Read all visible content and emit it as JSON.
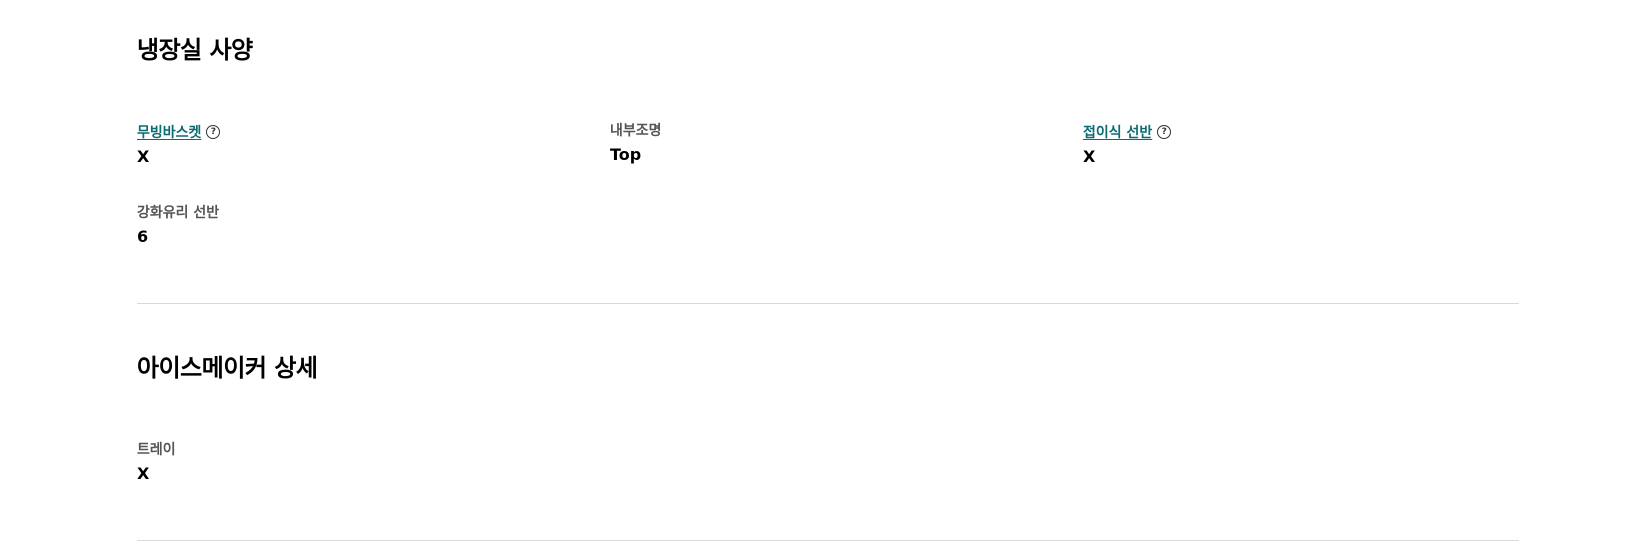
{
  "fridge_section": {
    "title": "냉장실 사양",
    "specs": [
      {
        "label": "무빙바스켓",
        "value": "X",
        "has_help": true
      },
      {
        "label": "내부조명",
        "value": "Top",
        "has_help": false
      },
      {
        "label": "접이식 선반",
        "value": "X",
        "has_help": true
      },
      {
        "label": "강화유리 선반",
        "value": "6",
        "has_help": false
      }
    ]
  },
  "icemaker_section": {
    "title": "아이스메이커 상세",
    "specs": [
      {
        "label": "트레이",
        "value": "X",
        "has_help": false
      }
    ]
  },
  "icons": {
    "help": "question-circle-icon",
    "help_glyph": "?"
  },
  "colors": {
    "link": "#0b6b73",
    "label": "#555555",
    "divider": "#d9d9d9"
  }
}
